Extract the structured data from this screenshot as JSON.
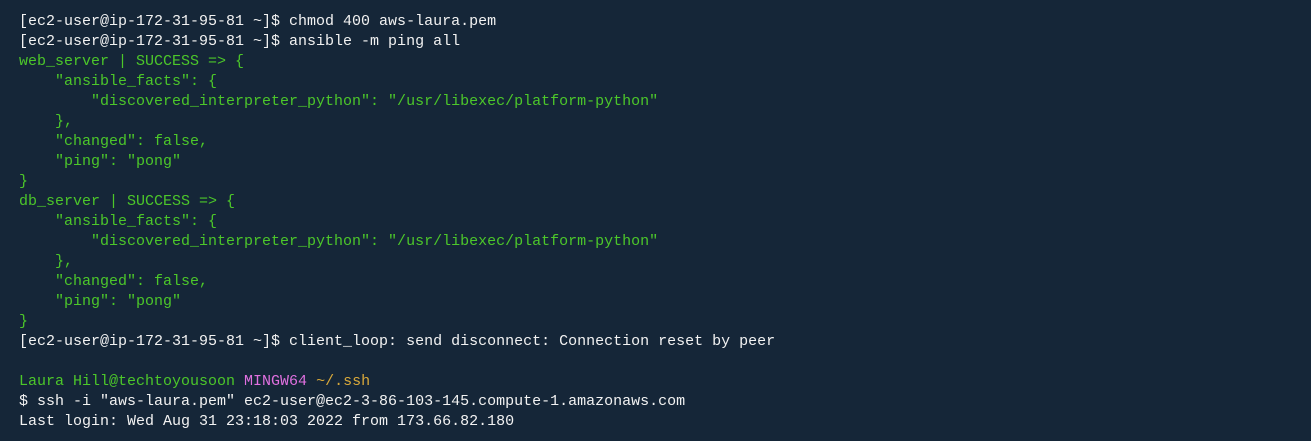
{
  "colors": {
    "background": "#152638",
    "text": "#f2f2f2",
    "green": "#4cc72a",
    "magenta": "#e070e0",
    "yellow": "#d9a93a"
  },
  "lines": [
    {
      "segments": [
        {
          "t": "[ec2-user@ip-172-31-95-81 ~]$ chmod 400 aws-laura.pem",
          "c": "w"
        }
      ]
    },
    {
      "segments": [
        {
          "t": "[ec2-user@ip-172-31-95-81 ~]$ ansible -m ping all",
          "c": "w"
        }
      ]
    },
    {
      "segments": [
        {
          "t": "web_server | SUCCESS => {",
          "c": "g"
        }
      ]
    },
    {
      "segments": [
        {
          "t": "    \"ansible_facts\": {",
          "c": "g"
        }
      ]
    },
    {
      "segments": [
        {
          "t": "        \"discovered_interpreter_python\": \"/usr/libexec/platform-python\"",
          "c": "g"
        }
      ]
    },
    {
      "segments": [
        {
          "t": "    },",
          "c": "g"
        }
      ]
    },
    {
      "segments": [
        {
          "t": "    \"changed\": false,",
          "c": "g"
        }
      ]
    },
    {
      "segments": [
        {
          "t": "    \"ping\": \"pong\"",
          "c": "g"
        }
      ]
    },
    {
      "segments": [
        {
          "t": "}",
          "c": "g"
        }
      ]
    },
    {
      "segments": [
        {
          "t": "db_server | SUCCESS => {",
          "c": "g"
        }
      ]
    },
    {
      "segments": [
        {
          "t": "    \"ansible_facts\": {",
          "c": "g"
        }
      ]
    },
    {
      "segments": [
        {
          "t": "        \"discovered_interpreter_python\": \"/usr/libexec/platform-python\"",
          "c": "g"
        }
      ]
    },
    {
      "segments": [
        {
          "t": "    },",
          "c": "g"
        }
      ]
    },
    {
      "segments": [
        {
          "t": "    \"changed\": false,",
          "c": "g"
        }
      ]
    },
    {
      "segments": [
        {
          "t": "    \"ping\": \"pong\"",
          "c": "g"
        }
      ]
    },
    {
      "segments": [
        {
          "t": "}",
          "c": "g"
        }
      ]
    },
    {
      "segments": [
        {
          "t": "[ec2-user@ip-172-31-95-81 ~]$ client_loop: send disconnect: Connection reset by peer",
          "c": "w"
        }
      ]
    },
    {
      "segments": []
    },
    {
      "segments": [
        {
          "t": "Laura Hill@techtoyousoon ",
          "c": "g"
        },
        {
          "t": "MINGW64 ",
          "c": "m"
        },
        {
          "t": "~/.ssh",
          "c": "y"
        }
      ]
    },
    {
      "segments": [
        {
          "t": "$ ssh -i \"aws-laura.pem\" ec2-user@ec2-3-86-103-145.compute-1.amazonaws.com",
          "c": "w"
        }
      ]
    },
    {
      "segments": [
        {
          "t": "Last login: Wed Aug 31 23:18:03 2022 from 173.66.82.180",
          "c": "w"
        }
      ]
    }
  ]
}
